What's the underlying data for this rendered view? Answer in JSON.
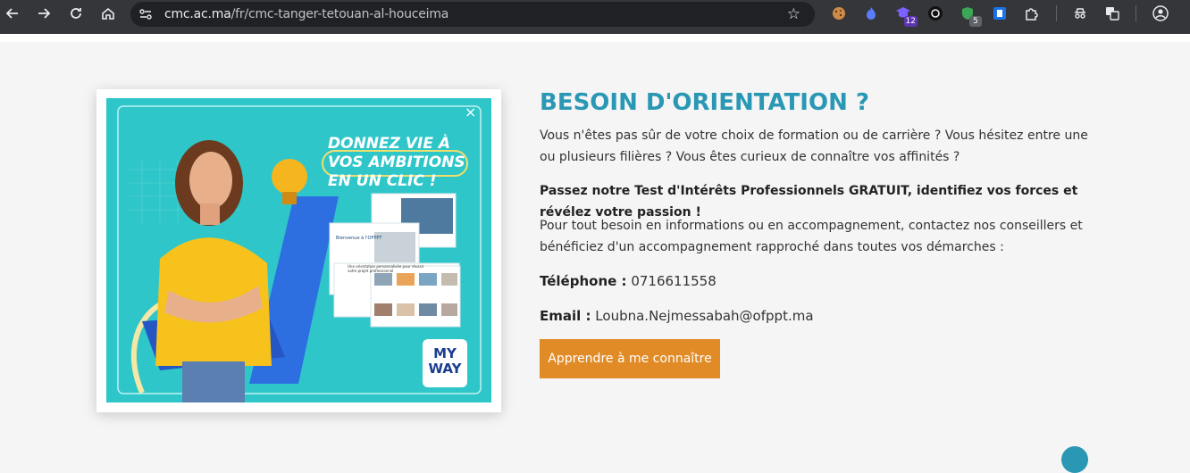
{
  "browser": {
    "url_host": "cmc.ac.ma",
    "url_path": "/fr/cmc-tanger-tetouan-al-houceima",
    "extensions": [
      {
        "name": "cookie-extension-icon",
        "badge": ""
      },
      {
        "name": "flame-extension-icon",
        "badge": ""
      },
      {
        "name": "graduation-extension-icon",
        "badge": "12"
      },
      {
        "name": "loop-extension-icon",
        "badge": ""
      },
      {
        "name": "shield-extension-icon",
        "badge": "5"
      },
      {
        "name": "blue-tag-extension-icon",
        "badge": ""
      },
      {
        "name": "puzzle-extensions-icon",
        "badge": ""
      },
      {
        "name": "spy-icon",
        "badge": ""
      },
      {
        "name": "translate-icon",
        "badge": ""
      },
      {
        "name": "profile-avatar-icon",
        "badge": ""
      }
    ]
  },
  "promo": {
    "headline_1": "DONNEZ VIE À",
    "headline_2": "VOS AMBITIONS",
    "headline_3": "EN UN CLIC !",
    "close": "×",
    "logo_top": "MY",
    "logo_bottom": "WAY",
    "screen_text": "Bienvenue à l'OFPPT",
    "screen_sub": "Une orientation personnalisée pour réussir votre projet professionnel"
  },
  "section": {
    "title": "BESOIN D'ORIENTATION ?",
    "p1": "Vous n'êtes pas sûr de votre choix de formation ou de carrière ? Vous hésitez entre une ou plusieurs filières ? Vous êtes curieux de connaître vos affinités ?",
    "p2": "Passez notre Test d'Intérêts Professionnels GRATUIT, identifiez vos forces et révélez votre passion !",
    "p3": "Pour tout besoin en informations ou en accompagnement, contactez nos conseillers et bénéficiez d'un accompagnement rapproché dans toutes vos démarches :",
    "phone_label": "Téléphone :",
    "phone_value": "0716611558",
    "email_label": "Email :",
    "email_value": "Loubna.Nejmessabah@ofppt.ma",
    "cta_label": "Apprendre à me connaître"
  },
  "colors": {
    "accent": "#2a98b4",
    "button": "#e18b26",
    "promo_bg": "#2fc6c9"
  }
}
